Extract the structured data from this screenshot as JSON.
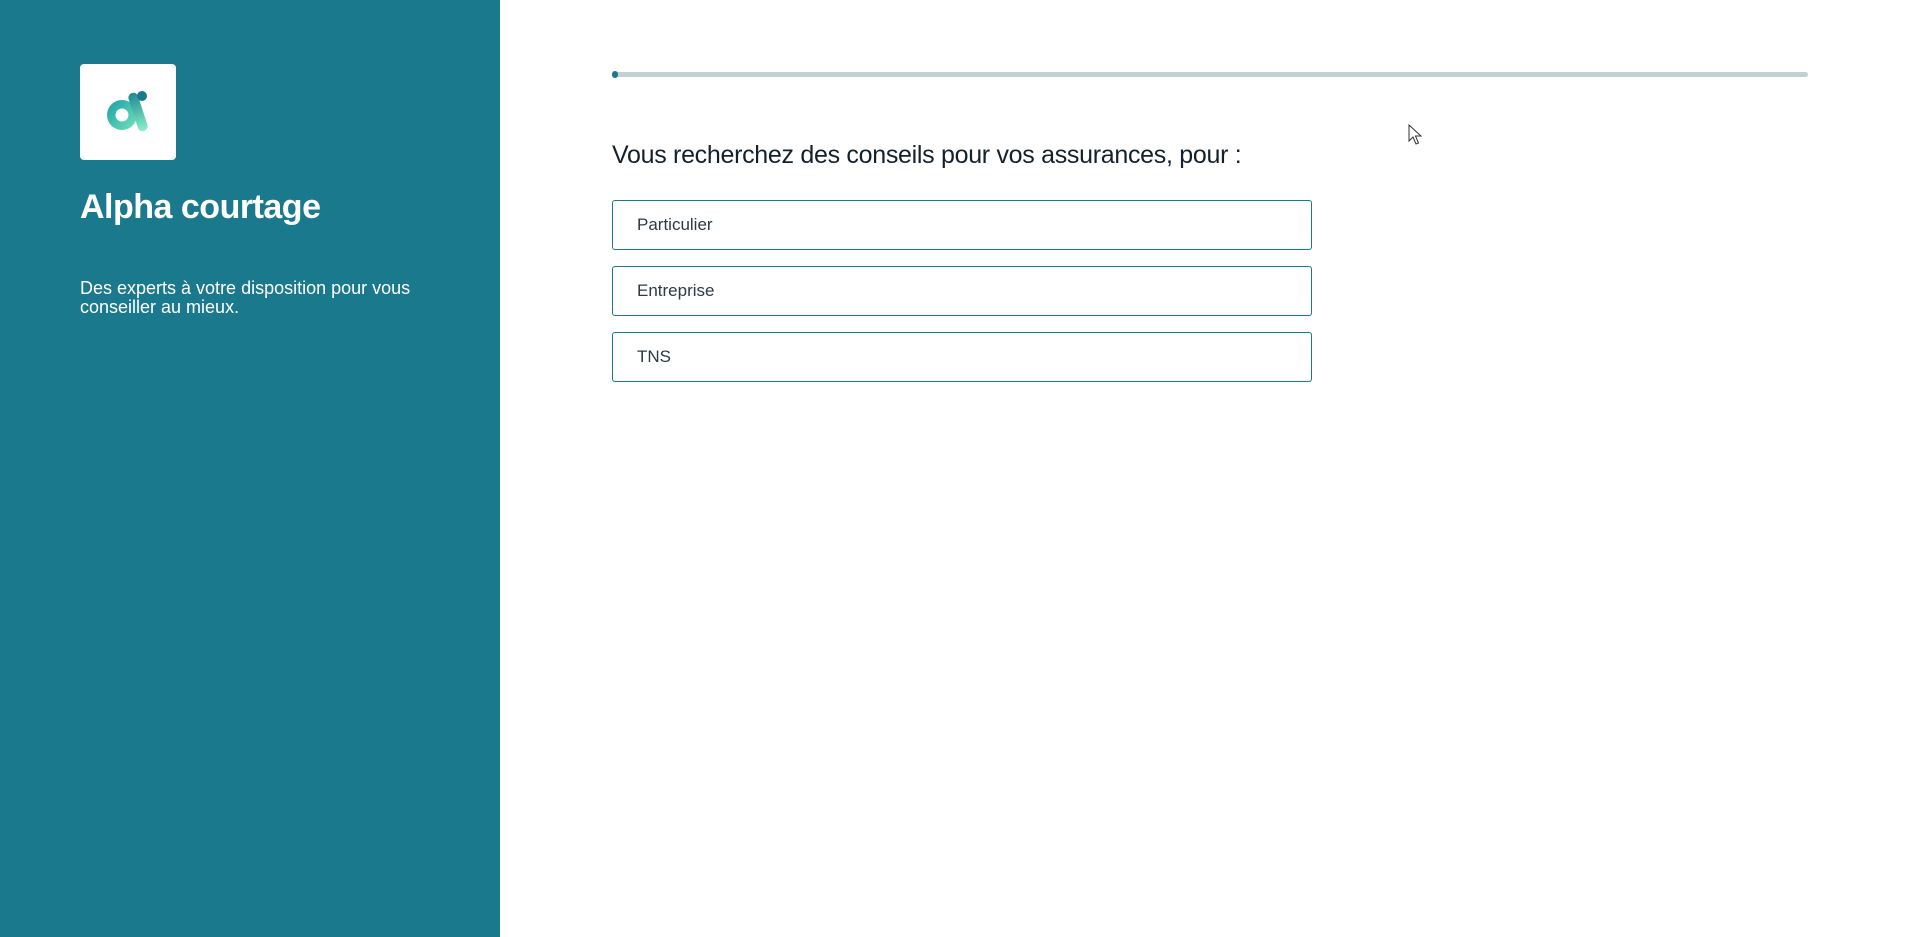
{
  "sidebar": {
    "logo_icon": "alpha-logo-icon",
    "brand_name": "Alpha courtage",
    "tagline": "Des experts à votre disposition pour vous conseiller au mieux."
  },
  "main": {
    "progress_fraction": 0.005,
    "question": "Vous recherchez des conseils pour vos assurances, pour :",
    "options": [
      {
        "label": "Particulier"
      },
      {
        "label": "Entreprise"
      },
      {
        "label": "TNS"
      }
    ]
  },
  "colors": {
    "brand_teal": "#1b798d",
    "progress_track": "#c5cfd3",
    "logo_gradient_start": "#1fa8a8",
    "logo_gradient_end": "#6fe0b8"
  }
}
